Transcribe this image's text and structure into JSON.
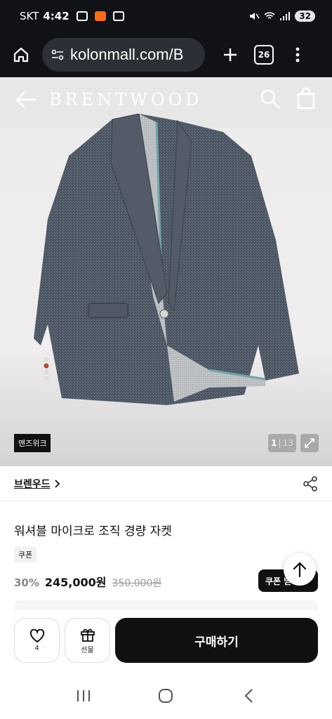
{
  "status": {
    "carrier": "SKT",
    "time": "4:42",
    "battery": "32"
  },
  "browser": {
    "url": "kolonmall.com/B",
    "tab_count": "26"
  },
  "header": {
    "brand_logo": "BRENTWOOD"
  },
  "hero": {
    "badge": "맨즈위크",
    "page_current": "1",
    "page_total": "13"
  },
  "brand": {
    "name": "브렌우드"
  },
  "product": {
    "title": "워셔블 마이크로 조직 경량 자켓",
    "coupon_tag": "쿠폰",
    "discount": "30%",
    "price": "245,000원",
    "original_price": "350,000원",
    "coupon_button": "쿠폰 받기"
  },
  "actions": {
    "like_count": "4",
    "gift_label": "선물",
    "buy_label": "구매하기"
  },
  "icons": [
    "home-icon",
    "site-settings-icon",
    "plus-icon",
    "tabs-icon",
    "more-icon",
    "back-arrow-icon",
    "search-icon",
    "shopping-bag-icon",
    "expand-icon",
    "chevron-right-icon",
    "share-icon",
    "arrow-up-icon",
    "heart-icon",
    "gift-icon",
    "recent-apps-icon",
    "home-circle-icon",
    "back-chevron-icon"
  ]
}
